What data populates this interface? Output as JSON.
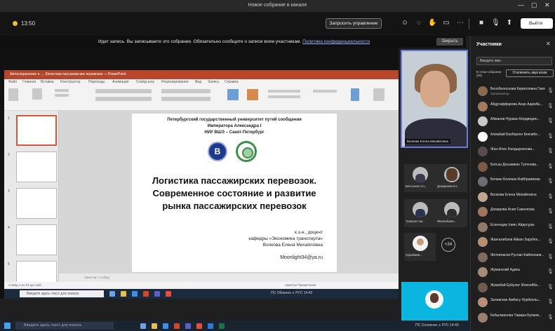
{
  "window": {
    "title": "Новое собрание в канале",
    "controls": [
      "—",
      "▢",
      "✕"
    ]
  },
  "meeting": {
    "timer": "13:50",
    "stop_control_label": "Запросить управление",
    "leave_label": "Выйти",
    "recording_banner": "Идет запись. Вы записываете это собрание. Обязательно сообщите о записи всем участникам.",
    "privacy_link": "Политика конфиденциальности",
    "banner_close": "Закрыть",
    "icons": [
      "people-icon",
      "chat-icon",
      "raise-hand-icon",
      "rooms-icon",
      "more-icon",
      "camera-icon",
      "mic-icon",
      "share-icon"
    ]
  },
  "powerpoint": {
    "ribbon_tabs": [
      "Файл",
      "Главная",
      "Вставка",
      "Конструктор",
      "Переходы",
      "Анимация",
      "Слайд-шоу",
      "Рецензирование",
      "Вид",
      "Запись",
      "Справка"
    ],
    "title_bar_text": "Автосохранение  ●  …  Логистика пассажирских перевозок — PowerPoint",
    "notes_placeholder": "Заметки к слайду",
    "status_left": "Слайд 1 из 23     русский",
    "status_right": "Заметки     Примечания"
  },
  "slide": {
    "header_line1": "Петербургский государственный университет путей сообщения",
    "header_line2": "Императора Александра I",
    "header_line3": "НИУ ВШЭ – Санкт-Петербург",
    "title_line1": "Логистика пассажирских перевозок.",
    "title_line2": "Современное состояние и развитие",
    "title_line3": "рынка пассажирских перевозок",
    "author_line1": "к.э.н., доцент",
    "author_line2": "кафедры «Экономика транспорта»",
    "author_line3": "Волкова Елена Михайловна",
    "email": "Moonlight34@ya.ru"
  },
  "thumbnails": [
    "1",
    "2",
    "3",
    "4",
    "5",
    "6"
  ],
  "inner_taskbar": {
    "search_placeholder": "Введите здесь текст для поиска",
    "tray": "ПС Облачно   ∧  РУС  14:43"
  },
  "video": {
    "presenter_name": "Волкова Елена Михайловна",
    "tiles": [
      {
        "label": "Бессонов Ал..."
      },
      {
        "label": "Домарова Ел..."
      },
      {
        "label": "Тукеров Ам..."
      },
      {
        "label": "Жилкибаев..."
      },
      {
        "label": "Оразбаев..."
      }
    ],
    "more_count": "+24"
  },
  "participants": {
    "title": "Участники",
    "search_placeholder": "Введите имя",
    "subheader": "В этом собрании (29)",
    "mute_all": "Отключить звук всем",
    "list": [
      {
        "name": "Белоболоснова Кирилловна Гикова...",
        "role": "Организатор"
      },
      {
        "name": "Абдугаффарова Анар Адемба...",
        "role": ""
      },
      {
        "name": "Абжанов Нуржан Бердиндин...",
        "role": ""
      },
      {
        "name": "Алмабай Бахберген Бековбе...",
        "role": ""
      },
      {
        "name": "Жан-Илес Балдырзонова...",
        "role": ""
      },
      {
        "name": "Батыш Досымжан Туленова...",
        "role": ""
      },
      {
        "name": "Бегжан Болекан Байбраимова",
        "role": ""
      },
      {
        "name": "Волкова Елена Михайловна",
        "role": ""
      },
      {
        "name": "Домарова Асия Сакенпова",
        "role": ""
      },
      {
        "name": "Есенгедер Ілияс Айдосұлы",
        "role": ""
      },
      {
        "name": "Жангалибаев Айкан Зарубек...",
        "role": ""
      },
      {
        "name": "Жоткеевсов Руслан Кайполаев...",
        "role": ""
      },
      {
        "name": "Жумагалий Адиль",
        "role": ""
      },
      {
        "name": "Жумабай Ербулат Жексейба...",
        "role": ""
      },
      {
        "name": "Залевская Амбису Нурбеклы...",
        "role": ""
      },
      {
        "name": "Кабылжанова Тамара Бупаев...",
        "role": ""
      }
    ]
  },
  "taskbar": {
    "search_placeholder": "Введите здесь текст для поиска",
    "tray": "ПС Солнечно  ∧  РУС  14:43"
  },
  "colors": {
    "accent": "#6b7bd8",
    "ppt_red": "#b7472a",
    "record": "#e8c232"
  }
}
